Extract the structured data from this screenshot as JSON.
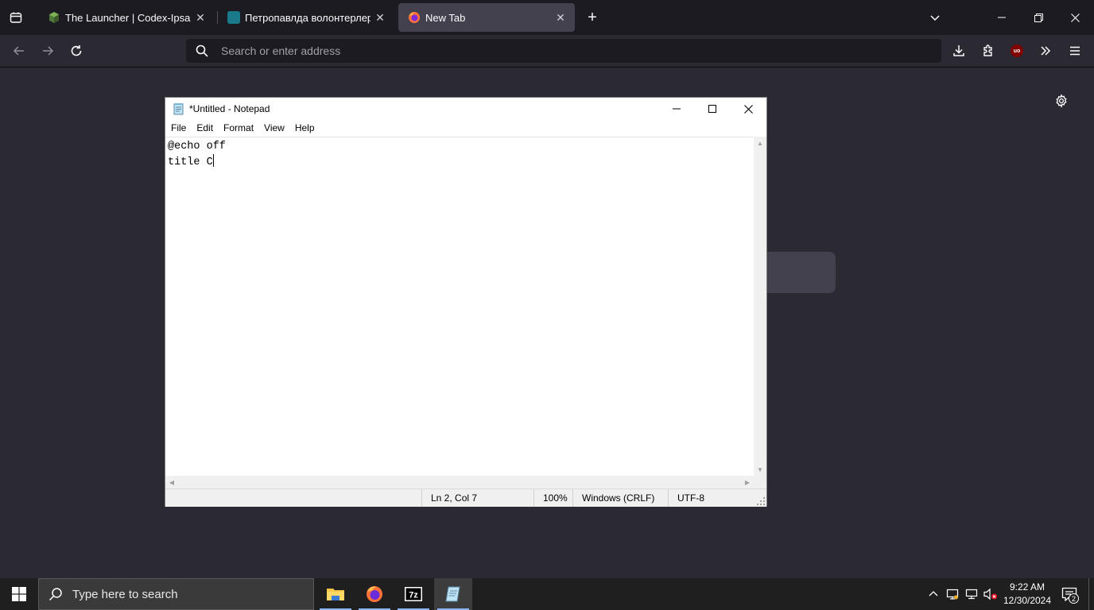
{
  "browser": {
    "tabs": [
      {
        "title": "The Launcher | Codex-Ipsa",
        "active": false,
        "favicon": "cube-icon"
      },
      {
        "title": "Петропавлда волонтерлер ан",
        "active": false,
        "favicon": "site-icon"
      },
      {
        "title": "New Tab",
        "active": true,
        "favicon": "firefox-icon"
      }
    ],
    "address_placeholder": "Search or enter address",
    "ublock_label": "uo"
  },
  "notepad": {
    "window_title": "*Untitled - Notepad",
    "menu": [
      "File",
      "Edit",
      "Format",
      "View",
      "Help"
    ],
    "text_lines": [
      "@echo off",
      "title C"
    ],
    "status": {
      "position": "Ln 2, Col 7",
      "zoom": "100%",
      "line_endings": "Windows (CRLF)",
      "encoding": "UTF-8"
    }
  },
  "taskbar": {
    "search_placeholder": "Type here to search",
    "apps": [
      "file-explorer",
      "firefox",
      "7-zip",
      "notepad"
    ],
    "clock_time": "9:22 AM",
    "clock_date": "12/30/2024",
    "notification_count": "2"
  },
  "colors": {
    "browser_bg": "#2b2a33",
    "tabstrip_bg": "#1c1b22",
    "active_tab": "#42414d",
    "taskbar_bg": "#1f1f1f",
    "ublock_red": "#800000"
  }
}
